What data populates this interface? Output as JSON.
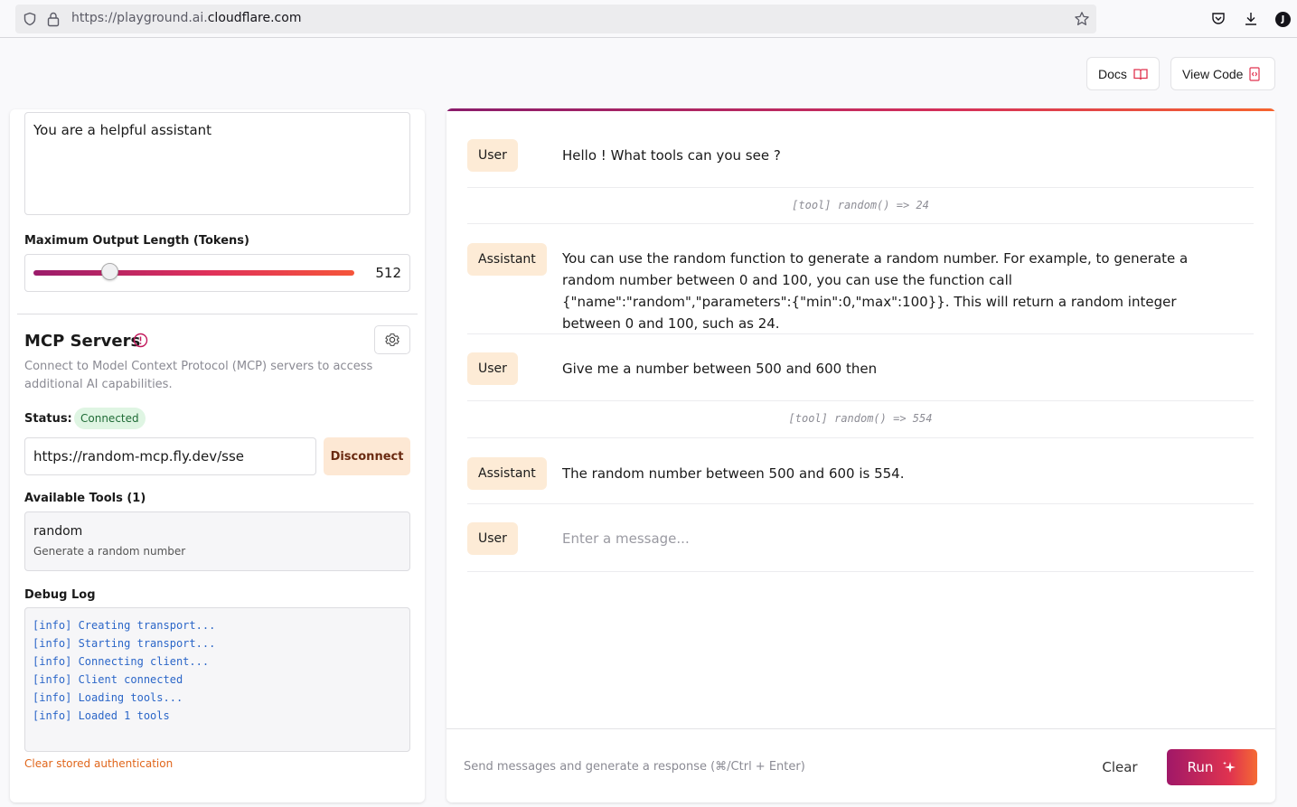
{
  "browser": {
    "url_prefix": "https://playground.ai.",
    "url_host": "cloudflare.com",
    "profile_initial": "J"
  },
  "header": {
    "docs_label": "Docs",
    "view_code_label": "View Code"
  },
  "settings": {
    "system_prompt": "You are a helpful assistant",
    "max_tokens_label": "Maximum Output Length (Tokens)",
    "max_tokens_value": "512",
    "max_tokens_fraction": 0.24
  },
  "mcp": {
    "title": "MCP Servers",
    "description": "Connect to Model Context Protocol (MCP) servers to access additional AI capabilities.",
    "status_label": "Status:",
    "status_value": "Connected",
    "server_url": "https://random-mcp.fly.dev/sse",
    "disconnect_label": "Disconnect",
    "tools_label": "Available Tools (1)",
    "tools": [
      {
        "name": "random",
        "description": "Generate a random number"
      }
    ],
    "debug_label": "Debug Log",
    "debug_log": [
      "[info] Creating transport...",
      "[info] Starting transport...",
      "[info] Connecting client...",
      "[info] Client connected",
      "[info] Loading tools...",
      "[info] Loaded 1 tools"
    ],
    "clear_auth_label": "Clear stored authentication"
  },
  "chat": {
    "messages": [
      {
        "role": "User",
        "text": "Hello ! What tools can you see ?"
      },
      {
        "tool": "[tool] random() => 24"
      },
      {
        "role": "Assistant",
        "text": "You can use the random function to generate a random number. For example, to generate a random number between 0 and 100, you can use the function call {\"name\":\"random\",\"parameters\":{\"min\":0,\"max\":100}}. This will return a random integer between 0 and 100, such as 24."
      },
      {
        "role": "User",
        "text": "Give me a number between 500 and 600 then"
      },
      {
        "tool": "[tool] random() => 554"
      },
      {
        "role": "Assistant",
        "text": "The random number between 500 and 600 is 554."
      }
    ],
    "input_role": "User",
    "input_placeholder": "Enter a message...",
    "footer_hint": "Send messages and generate a response (⌘/Ctrl + Enter)",
    "clear_label": "Clear",
    "run_label": "Run"
  },
  "colors": {
    "accent_start": "#9b1c6b",
    "accent_end": "#f5553a",
    "role_badge": "#fdebd6",
    "status_ok": "#dff5e3"
  }
}
